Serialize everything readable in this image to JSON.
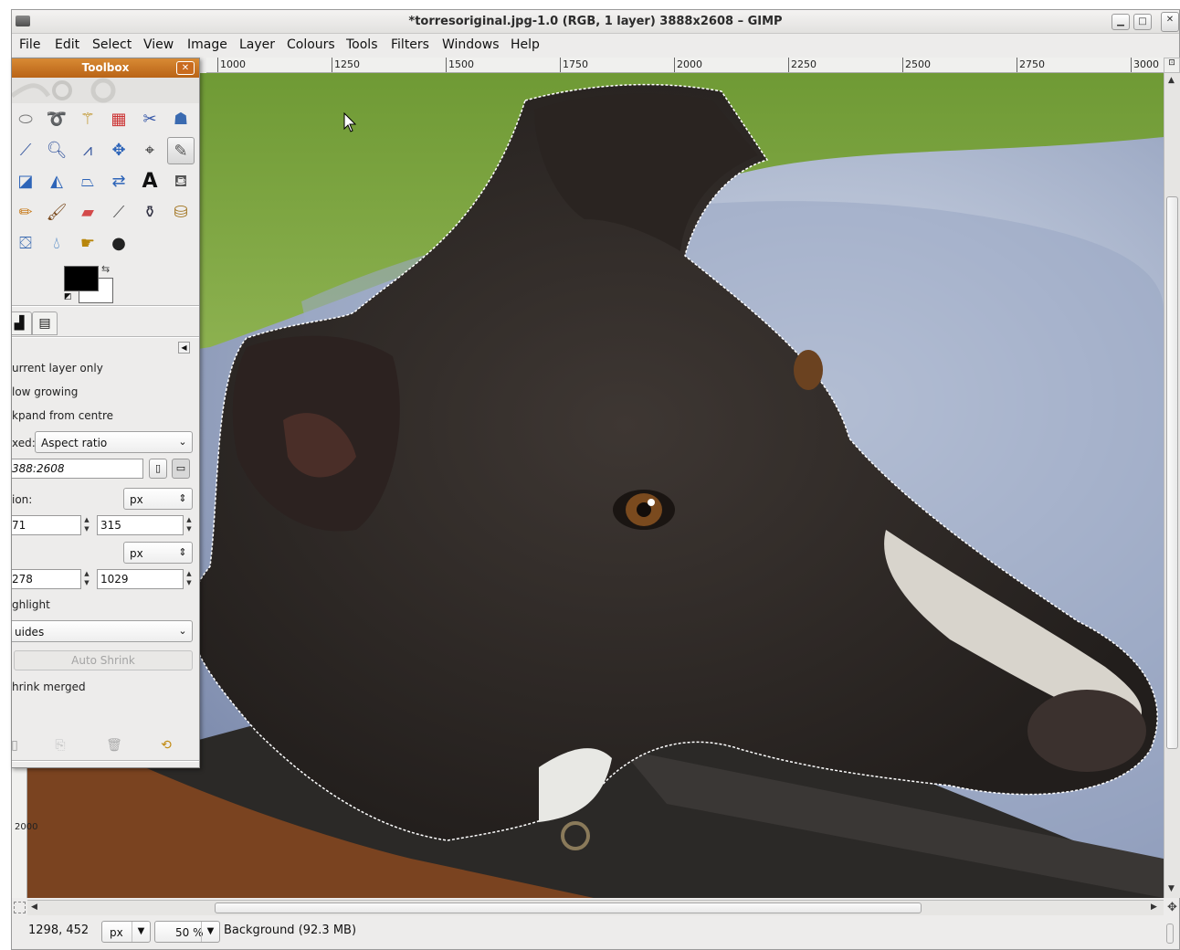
{
  "window": {
    "title": "*torresoriginal.jpg-1.0 (RGB, 1 layer) 3888x2608 – GIMP",
    "minimize_icon": "minimize-icon",
    "maximize_icon": "maximize-icon",
    "close_icon": "close-icon"
  },
  "menubar": {
    "items": [
      "File",
      "Edit",
      "Select",
      "View",
      "Image",
      "Layer",
      "Colours",
      "Tools",
      "Filters",
      "Windows",
      "Help"
    ]
  },
  "rulers": {
    "top_labels": [
      "1000",
      "1250",
      "1500",
      "1750",
      "2000",
      "2250",
      "2500",
      "2750",
      "3000"
    ],
    "left_label": "2000"
  },
  "toolbox": {
    "title": "Toolbox",
    "tools": [
      "rect-select-icon",
      "free-select-icon",
      "fuzzy-select-icon",
      "select-by-color-icon",
      "scissors-icon",
      "foreground-select-icon",
      "paths-icon",
      "color-picker-icon",
      "zoom-icon",
      "measure-icon",
      "move-icon",
      "align-icon",
      "crop-icon",
      "rotate-icon",
      "scale-icon",
      "shear-icon",
      "perspective-icon",
      "flip-icon",
      "text-icon",
      "bucket-fill-icon",
      "pencil-icon",
      "paintbrush-icon",
      "eraser-icon",
      "airbrush-icon",
      "ink-icon",
      "clone-icon",
      "heal-icon",
      "blur-icon",
      "smudge-icon",
      "dodge-burn-icon"
    ],
    "colors": {
      "foreground": "#000000",
      "background": "#ffffff"
    },
    "options": {
      "current_layer_only": "urrent layer only",
      "allow_growing": "low growing",
      "expand_from_centre": "kpand from centre",
      "fixed_label": "xed:",
      "fixed_value": "Aspect ratio",
      "ratio_value": "388:2608",
      "position_label": "ion:",
      "position_unit": "px",
      "position_x": "71",
      "position_y": "315",
      "size_unit": "px",
      "size_w": "278",
      "size_h": "1029",
      "highlight": "ghlight",
      "guides_value": "uides",
      "auto_shrink": "Auto Shrink",
      "shrink_merged": "hrink merged"
    }
  },
  "statusbar": {
    "coords": "1298, 452",
    "unit": "px",
    "zoom": "50 %",
    "message": "Background (92.3 MB)"
  }
}
